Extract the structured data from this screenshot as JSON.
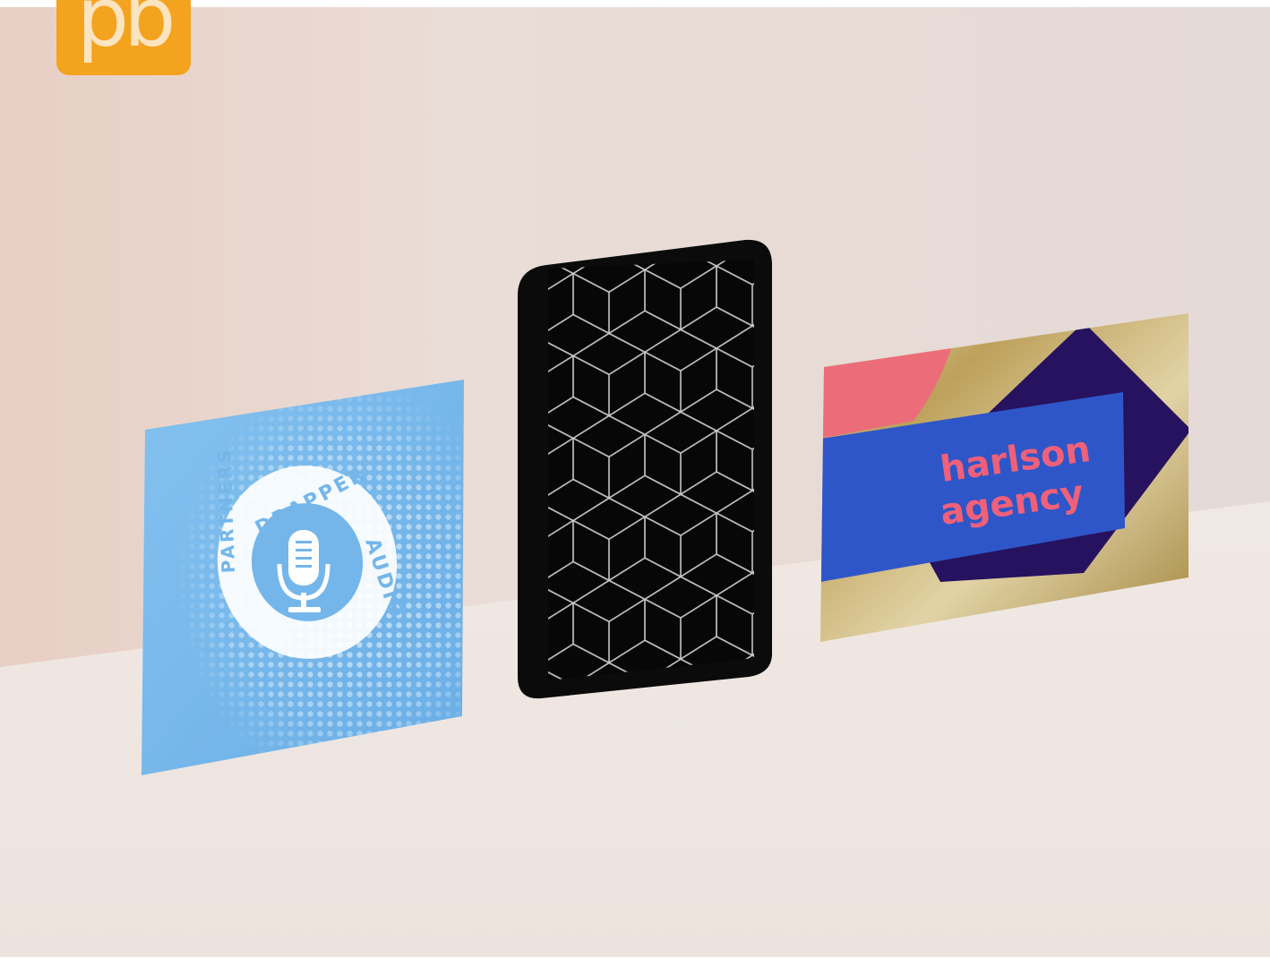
{
  "logo": {
    "text": "pb",
    "color": "#f4a31e",
    "icon": "pb-logo"
  },
  "cards": {
    "left": {
      "description": "light blue square card with embossed halftone dots",
      "badge_top": "DRAPPER",
      "badge_right": "AUDIO",
      "badge_bottom": "PARTNERS",
      "icon": "microphone-icon",
      "color": "#74b6ea"
    },
    "middle": {
      "description": "black card with silver foil cube pattern",
      "color": "#0b0b0b",
      "foil": "#bfbfbf"
    },
    "right": {
      "line1": "harlson",
      "line2": "agency",
      "text_color": "#f06079",
      "band_color": "#2f56c8",
      "diamond_color": "#26125f",
      "gold": "#b89a4c",
      "pink": "#ec6d79"
    }
  },
  "colors": {
    "wall": "#e6dad4",
    "floor": "#efe7e3"
  }
}
